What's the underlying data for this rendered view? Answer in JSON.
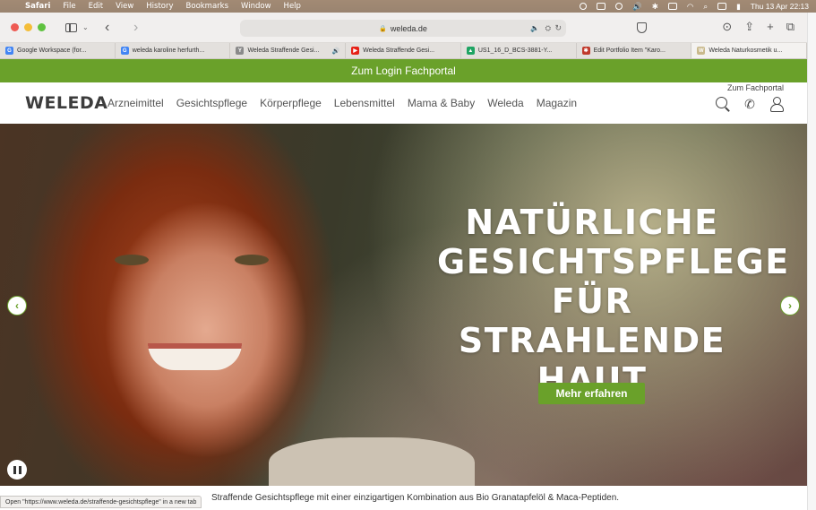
{
  "menubar": {
    "app": "Safari",
    "items": [
      "File",
      "Edit",
      "View",
      "History",
      "Bookmarks",
      "Window",
      "Help"
    ],
    "datetime": "Thu 13 Apr  22:13"
  },
  "toolbar": {
    "address": "weleda.de"
  },
  "tabs": [
    {
      "label": "Google Workspace (for...",
      "fav": "G",
      "fav_color": "#4285f4"
    },
    {
      "label": "weleda karoline herfurth...",
      "fav": "G",
      "fav_color": "#4285f4"
    },
    {
      "label": "Weleda Straffende Gesi...",
      "fav": "Y",
      "fav_color": "#8a8a8a",
      "audio": true
    },
    {
      "label": "Weleda Straffende Gesi...",
      "fav": "▶",
      "fav_color": "#e62117"
    },
    {
      "label": "US1_16_D_BCS-3881-Y...",
      "fav": "▲",
      "fav_color": "#1fa463"
    },
    {
      "label": "Edit Portfolio Item \"Karo...",
      "fav": "✱",
      "fav_color": "#c0392b"
    },
    {
      "label": "Weleda Naturkosmetik u...",
      "fav": "W",
      "fav_color": "#c9b98c",
      "active": true
    }
  ],
  "site": {
    "login_bar": "Zum Login Fachportal",
    "logo": "WELEDA",
    "nav": [
      "Arzneimittel",
      "Gesichtspflege",
      "Körperpflege",
      "Lebensmittel",
      "Mama & Baby",
      "Weleda",
      "Magazin"
    ],
    "fachportal": "Zum Fachportal"
  },
  "hero": {
    "title_lines": [
      "NATÜRLICHE",
      "GESICHTSPFLEGE",
      "FÜR STRAHLENDE",
      "HAUT"
    ],
    "cta": "Mehr erfahren",
    "subtext": "Straffende Gesichtspflege mit einer einzigartigen Kombination aus Bio Granatapfelöl & Maca-Peptiden."
  },
  "status": {
    "link_preview": "Open \"https://www.weleda.de/straffende-gesichtspflege\" in a new tab"
  },
  "colors": {
    "brand_green": "#6aa12a"
  }
}
